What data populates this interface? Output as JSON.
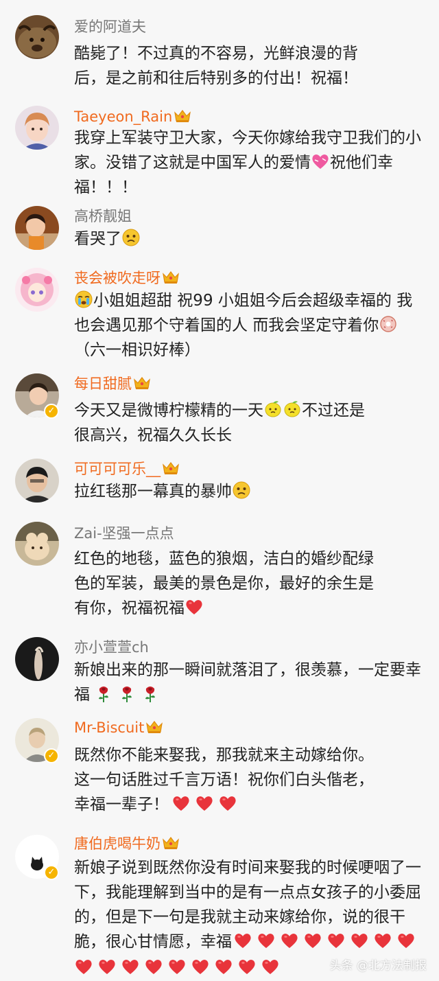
{
  "comments": [
    {
      "name": "爱的阿道夫",
      "lines": [
        "酷毙了！不过真的不容易，光鲜浪漫的背",
        "后，是之前和往后特别多的付出！祝福！"
      ]
    },
    {
      "name": "Taeyeon_Rain",
      "lines": [
        "我穿上军装守卫大家，今天你嫁给我守卫我们的小",
        "家。没错了这就是中国军人的爱情",
        "祝他们幸",
        "福！！！"
      ]
    },
    {
      "name": "高桥靓姐",
      "lines": [
        "看哭了"
      ]
    },
    {
      "name": "丧会被吹走呀",
      "lines": [
        "小姐姐超甜 祝99 小姐姐今后会超级幸福的 我",
        "也会遇见那个守着国的人 而我会坚定守着你",
        "（六一相识好棒）"
      ]
    },
    {
      "name": "每日甜腻",
      "lines": [
        "今天又是微博柠檬精的一天",
        "不过还是",
        "很高兴，祝福久久长长"
      ]
    },
    {
      "name": "可可可可乐__",
      "lines": [
        "拉红毯那一幕真的暴帅"
      ]
    },
    {
      "name": "Zai-坚强一点点",
      "lines": [
        "红色的地毯，蓝色的狼烟，洁白的婚纱配绿",
        "色的军装，最美的景色是你，最好的余生是",
        "有你，祝福祝福"
      ]
    },
    {
      "name": "亦小萱萱ch",
      "lines": [
        "新娘出来的那一瞬间就落泪了，很羡慕，一定要幸",
        "福"
      ]
    },
    {
      "name": "Mr-Biscuit",
      "lines": [
        "既然你不能来娶我，那我就来主动嫁给你。",
        "这一句话胜过千言万语！祝你们白头偕老，",
        "幸福一辈子！"
      ]
    },
    {
      "name": "唐伯虎喝牛奶",
      "lines": [
        "新娘子说到既然你没有时间来娶我的时候哽咽了一",
        "下，我能理解到当中的是有一点点女孩子的小委屈",
        "的，但是下一句是我就主动来嫁给你，说的很干",
        "脆，很心甘情愿，幸福"
      ]
    }
  ],
  "watermark": "头条 @北方法制报",
  "colors": {
    "name_member": "#f06a1f",
    "name_normal": "#777777",
    "verified": "#f6b400",
    "heart": "#e8343b",
    "background": "#f7f7f7"
  }
}
